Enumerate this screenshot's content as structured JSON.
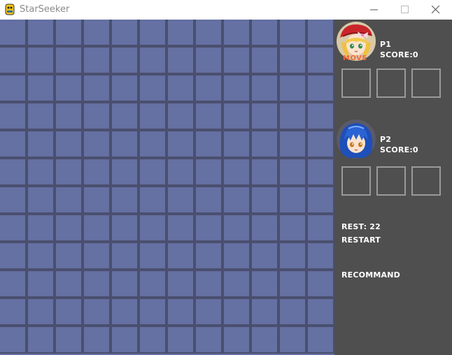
{
  "window": {
    "title": "StarSeeker",
    "icon": "python-icon",
    "controls": [
      "minimize-icon",
      "maximize-icon",
      "close-icon"
    ]
  },
  "board": {
    "rows": 12,
    "cols": 12,
    "cell_color": "#6570a3",
    "line_color": "#4a4f6e"
  },
  "panel": {
    "background": "#4f4f4f",
    "players": [
      {
        "name": "P1",
        "score_label": "SCORE:0",
        "status": "MOVE",
        "slots": 3,
        "avatar": "red-hat-girl-avatar"
      },
      {
        "name": "P2",
        "score_label": "SCORE:0",
        "status": "",
        "slots": 3,
        "avatar": "blue-hair-girl-avatar"
      }
    ],
    "rest_label": "REST: 22",
    "restart_label": "RESTART",
    "recommend_label": "RECOMMAND"
  }
}
